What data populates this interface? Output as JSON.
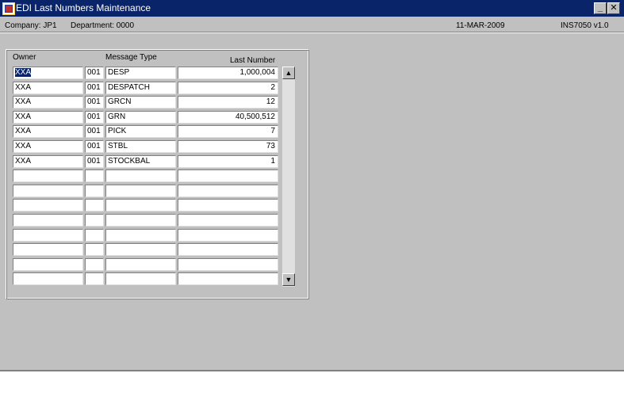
{
  "window": {
    "title": "EDI Last Numbers Maintenance",
    "minimize": "_",
    "close": "✕"
  },
  "info": {
    "company": "Company:  JP1",
    "department": "Department:  0000",
    "date": "11-MAR-2009",
    "program": "INS7050  v1.0"
  },
  "grid": {
    "headers": {
      "owner": "Owner",
      "message_type": "Message Type",
      "last_number": "Last Number"
    },
    "rows": [
      {
        "owner": "XXA",
        "code": "001",
        "type": "DESP",
        "last": "1,000,004"
      },
      {
        "owner": "XXA",
        "code": "001",
        "type": "DESPATCH",
        "last": "2"
      },
      {
        "owner": "XXA",
        "code": "001",
        "type": "GRCN",
        "last": "12"
      },
      {
        "owner": "XXA",
        "code": "001",
        "type": "GRN",
        "last": "40,500,512"
      },
      {
        "owner": "XXA",
        "code": "001",
        "type": "PICK",
        "last": "7"
      },
      {
        "owner": "XXA",
        "code": "001",
        "type": "STBL",
        "last": "73"
      },
      {
        "owner": "XXA",
        "code": "001",
        "type": "STOCKBAL",
        "last": "1"
      },
      {
        "owner": "",
        "code": "",
        "type": "",
        "last": ""
      },
      {
        "owner": "",
        "code": "",
        "type": "",
        "last": ""
      },
      {
        "owner": "",
        "code": "",
        "type": "",
        "last": ""
      },
      {
        "owner": "",
        "code": "",
        "type": "",
        "last": ""
      },
      {
        "owner": "",
        "code": "",
        "type": "",
        "last": ""
      },
      {
        "owner": "",
        "code": "",
        "type": "",
        "last": ""
      },
      {
        "owner": "",
        "code": "",
        "type": "",
        "last": ""
      },
      {
        "owner": "",
        "code": "",
        "type": "",
        "last": ""
      }
    ]
  },
  "scrollbar": {
    "up": "▲",
    "down": "▼"
  },
  "colors": {
    "titlebar": "#0a246a",
    "face": "#c0c0c0",
    "selection": "#0a246a"
  },
  "icons": {
    "app": "oracle-forms-app-icon"
  }
}
